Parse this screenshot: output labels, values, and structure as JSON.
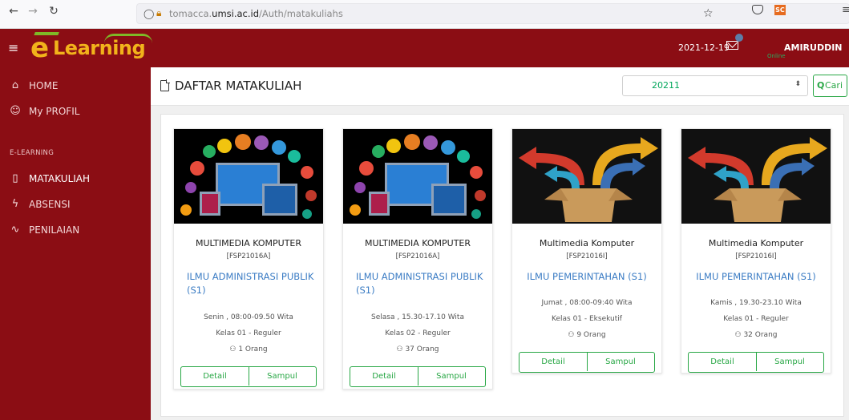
{
  "browser": {
    "url_prefix": "tomacca.",
    "url_domain": "umsi.ac.id",
    "url_path": "/Auth/matakuliahs",
    "ext_label": "SC"
  },
  "topbar": {
    "logo_text": "eLearning",
    "date": "2021-12-19",
    "online_label": "Online",
    "username": "AMIRUDDIN"
  },
  "sidebar": {
    "items": [
      {
        "label": "HOME"
      },
      {
        "label": "My PROFIL"
      }
    ],
    "group_label": "E-LEARNING",
    "group_items": [
      {
        "label": "MATAKULIAH"
      },
      {
        "label": "ABSENSI"
      },
      {
        "label": "PENILAIAN"
      }
    ]
  },
  "header": {
    "title": "DAFTAR MATAKULIAH",
    "semester_value": "20211",
    "search_label": "Cari"
  },
  "cards": [
    {
      "title": "MULTIMEDIA KOMPUTER",
      "code": "[FSP21016A]",
      "prodi": "ILMU ADMINISTRASI PUBLIK (S1)",
      "schedule": "Senin , 08:00-09.50 Wita",
      "kelas": "Kelas 01 - Reguler",
      "peserta": "1 Orang",
      "detail": "Detail",
      "sampul": "Sampul"
    },
    {
      "title": "MULTIMEDIA KOMPUTER",
      "code": "[FSP21016A]",
      "prodi": "ILMU ADMINISTRASI PUBLIK (S1)",
      "schedule": "Selasa , 15.30-17.10 Wita",
      "kelas": "Kelas 02 - Reguler",
      "peserta": "37 Orang",
      "detail": "Detail",
      "sampul": "Sampul"
    },
    {
      "title": "Multimedia Komputer",
      "code": "[FSP21016I]",
      "prodi": "ILMU PEMERINTAHAN (S1)",
      "schedule": "Jumat , 08:00-09:40 Wita",
      "kelas": "Kelas 01 - Eksekutif",
      "peserta": "9 Orang",
      "detail": "Detail",
      "sampul": "Sampul"
    },
    {
      "title": "Multimedia Komputer",
      "code": "[FSP21016I]",
      "prodi": "ILMU PEMERINTAHAN (S1)",
      "schedule": "Kamis , 19.30-23.10 Wita",
      "kelas": "Kelas 01 - Reguler",
      "peserta": "32 Orang",
      "detail": "Detail",
      "sampul": "Sampul"
    }
  ],
  "colors": {
    "brand_red": "#8b0d14",
    "logo_yellow": "#f2b31b",
    "accent_green": "#28a745",
    "link_blue": "#3b7cc4"
  }
}
